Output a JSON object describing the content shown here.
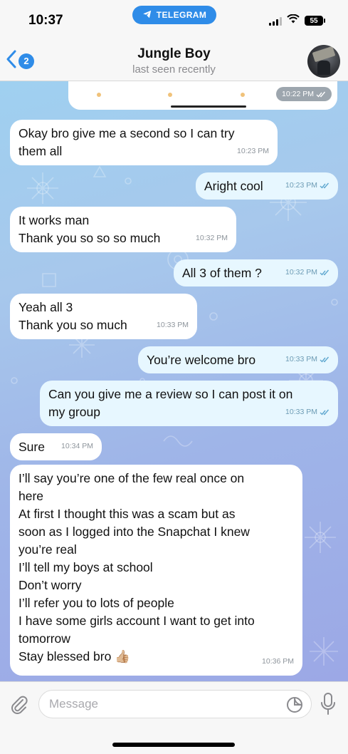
{
  "status_bar": {
    "time": "10:37",
    "app_pill": "TELEGRAM",
    "battery": "55"
  },
  "header": {
    "back_badge": "2",
    "contact_name": "Jungle Boy",
    "contact_status": "last seen recently",
    "cut_message_time": "10:22 PM"
  },
  "messages": [
    {
      "dir": "in",
      "text": "Okay bro give me a second so I can try\nthem all",
      "time": "10:23 PM"
    },
    {
      "dir": "out",
      "text": "Aright cool",
      "time": "10:23 PM"
    },
    {
      "dir": "in",
      "text": "It works man\nThank you so so so much",
      "time": "10:32 PM"
    },
    {
      "dir": "out",
      "text": "All 3 of them ?",
      "time": "10:32 PM"
    },
    {
      "dir": "in",
      "text": "Yeah all 3\nThank you so much",
      "time": "10:33 PM"
    },
    {
      "dir": "out",
      "text": "You’re welcome bro",
      "time": "10:33 PM"
    },
    {
      "dir": "out",
      "text": "Can you give me a review so I can post it on\nmy group",
      "time": "10:33 PM"
    },
    {
      "dir": "in",
      "text": "Sure",
      "time": "10:34 PM"
    },
    {
      "dir": "in",
      "text": "I’ll say you’re one of the few real once on\nhere\nAt first I thought this was a scam but as\nsoon as I logged into the Snapchat I knew\nyou’re real\nI’ll tell my boys at school\nDon’t worry\nI’ll refer you to lots of people\nI have some girls account I want to get into\ntomorrow\nStay blessed bro 👍🏼",
      "time": "10:36 PM"
    }
  ],
  "input": {
    "placeholder": "Message"
  },
  "icons": {
    "back": "chevron-left-icon",
    "telegram": "paper-plane-icon",
    "attach": "paperclip-icon",
    "sticker": "sticker-icon",
    "mic": "microphone-icon",
    "read_receipt": "double-check-icon"
  },
  "colors": {
    "accent": "#2f8ce8",
    "incoming_bubble": "#ffffff",
    "outgoing_bubble": "#e7f7ff",
    "timestamp": "#8e959c"
  }
}
